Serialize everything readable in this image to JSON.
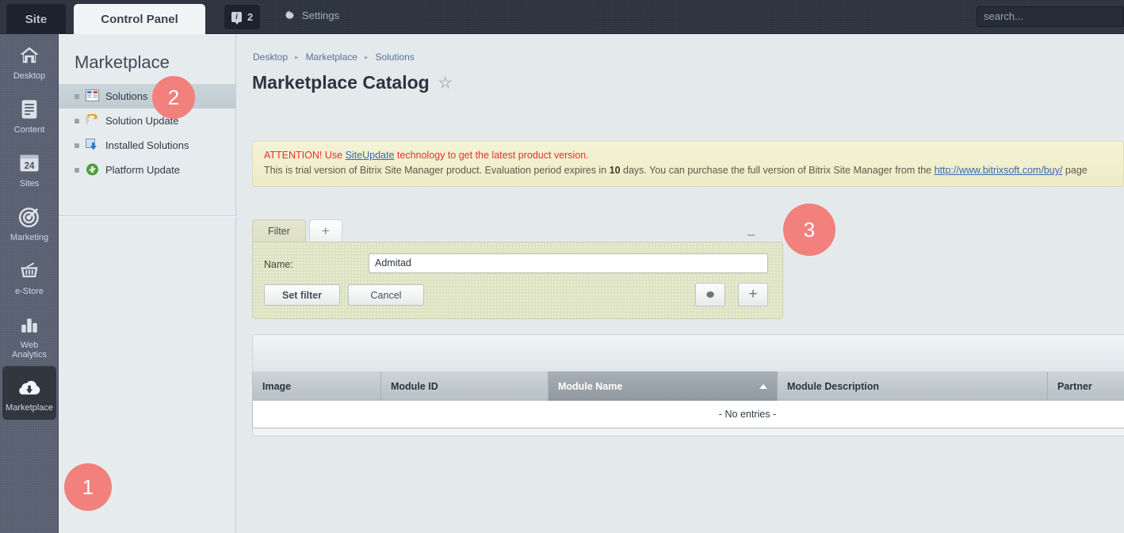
{
  "topbar": {
    "site_tab": "Site",
    "control_panel_tab": "Control Panel",
    "badge_count": "2",
    "badge_icon": "info-icon",
    "settings_label": "Settings",
    "settings_icon": "gear-icon",
    "search_placeholder": "search...",
    "search_value": ""
  },
  "rail": {
    "items": [
      {
        "label": "Desktop",
        "icon": "home-icon",
        "active": false
      },
      {
        "label": "Content",
        "icon": "document-icon",
        "active": false
      },
      {
        "label": "Sites",
        "icon": "window-24-icon",
        "active": false
      },
      {
        "label": "Marketing",
        "icon": "target-icon",
        "active": false
      },
      {
        "label": "e-Store",
        "icon": "basket-icon",
        "active": false
      },
      {
        "label": "Web\nAnalytics",
        "icon": "bar-chart-icon",
        "active": false
      },
      {
        "label": "Marketplace",
        "icon": "cloud-download-icon",
        "active": true
      }
    ]
  },
  "nav": {
    "title": "Marketplace",
    "items": [
      {
        "label": "Solutions",
        "icon": "solutions-grid-icon",
        "selected": true
      },
      {
        "label": "Solution Update",
        "icon": "solution-update-icon",
        "selected": false
      },
      {
        "label": "Installed Solutions",
        "icon": "installed-solutions-icon",
        "selected": false
      },
      {
        "label": "Platform Update",
        "icon": "platform-update-icon",
        "selected": false
      }
    ]
  },
  "breadcrumb": {
    "items": [
      "Desktop",
      "Marketplace",
      "Solutions"
    ],
    "separator": "▸"
  },
  "page": {
    "title": "Marketplace Catalog",
    "favorite_icon": "star-icon"
  },
  "notice": {
    "attention": "ATTENTION! Use ",
    "link_text": "SiteUpdate",
    "attention_tail": " technology to get the latest product version.",
    "line2_a": "This is trial version of Bitrix Site Manager product. Evaluation period expires in ",
    "days": "10",
    "line2_b": " days. You can purchase the full version of Bitrix Site Manager from the ",
    "buy_link": "http://www.bitrixsoft.com/buy/",
    "line2_c": " page"
  },
  "filter": {
    "tab_label": "Filter",
    "add_tab_label": "+",
    "collapse_icon": "minus-icon",
    "name_label": "Name:",
    "name_value": "Admitad",
    "name_placeholder": "",
    "set_filter_label": "Set filter",
    "cancel_label": "Cancel",
    "settings_icon": "gear-icon",
    "add_icon": "plus-icon"
  },
  "grid": {
    "columns": [
      "Image",
      "Module ID",
      "Module Name",
      "Module Description",
      "Partner"
    ],
    "sorted_column": "Module Name",
    "sort_direction": "asc",
    "empty_text": "- No entries -",
    "rows": []
  },
  "markers": [
    {
      "number": "1",
      "color": "#f2807d"
    },
    {
      "number": "2",
      "color": "#f2807d"
    },
    {
      "number": "3",
      "color": "#f2807d"
    }
  ]
}
